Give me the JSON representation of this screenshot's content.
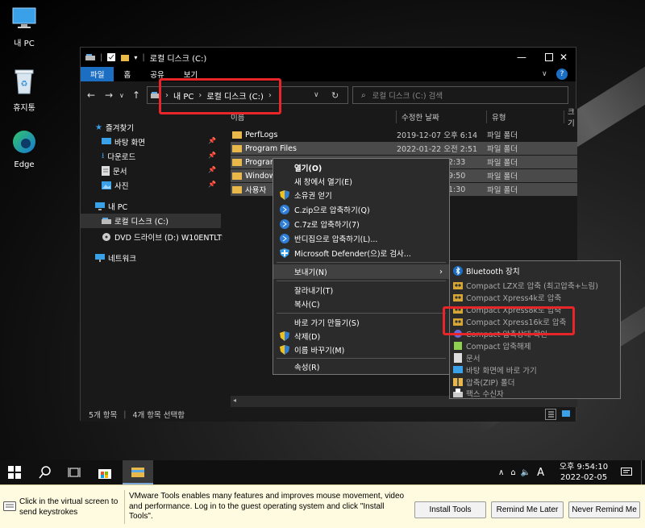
{
  "desktop": {
    "icons": [
      {
        "label": "내 PC",
        "icon": "computer-icon"
      },
      {
        "label": "휴지통",
        "icon": "recycle-bin-icon"
      },
      {
        "label": "Edge",
        "icon": "edge-icon"
      }
    ]
  },
  "window": {
    "title": "로컬 디스크 (C:)",
    "ribbon_tabs": [
      "파일",
      "홈",
      "공유",
      "보기"
    ],
    "address": {
      "crumbs": [
        "내 PC",
        "로컬 디스크 (C:)"
      ]
    },
    "search_placeholder": "로컬 디스크 (C:) 검색",
    "columns": [
      "이름",
      "수정한 날짜",
      "유형",
      "크기"
    ],
    "files": [
      {
        "name": "PerfLogs",
        "date": "2019-12-07 오후 6:14",
        "type": "파일 폴더",
        "selected": false
      },
      {
        "name": "Program Files",
        "date": "2022-01-22 오전 2:51",
        "type": "파일 폴더",
        "selected": true
      },
      {
        "name": "Program",
        "date": "2:33",
        "type": "파일 폴더",
        "selected": true
      },
      {
        "name": "Window",
        "date": "9:50",
        "type": "파일 폴더",
        "selected": true
      },
      {
        "name": "사용자",
        "date": "1:30",
        "type": "파일 폴더",
        "selected": true
      }
    ],
    "sidebar": [
      {
        "label": "즐겨찾기",
        "icon": "star-icon",
        "indent": 1,
        "pin": false
      },
      {
        "label": "바탕 화면",
        "icon": "desktop-icon",
        "indent": 2,
        "pin": true
      },
      {
        "label": "다운로드",
        "icon": "download-icon",
        "indent": 2,
        "pin": true
      },
      {
        "label": "문서",
        "icon": "document-icon",
        "indent": 2,
        "pin": true
      },
      {
        "label": "사진",
        "icon": "picture-icon",
        "indent": 2,
        "pin": true
      },
      {
        "label": "내 PC",
        "icon": "computer-icon",
        "indent": 1,
        "pin": false
      },
      {
        "label": "로컬 디스크 (C:)",
        "icon": "drive-icon",
        "indent": 2,
        "pin": false
      },
      {
        "label": "DVD 드라이브 (D:) W10ENTLTS",
        "icon": "dvd-icon",
        "indent": 2,
        "pin": false
      },
      {
        "label": "네트워크",
        "icon": "network-icon",
        "indent": 1,
        "pin": false
      }
    ],
    "status": {
      "count": "5개 항목",
      "selected": "4개 항목 선택함"
    }
  },
  "context_menu": {
    "items": [
      {
        "label": "열기(O)",
        "bold": true
      },
      {
        "label": "새 창에서 열기(E)"
      },
      {
        "label": "소유권 얻기",
        "icon": "shield-icon"
      },
      {
        "label": "C.zip으로 압축하기(Q)",
        "icon": "bandizip-icon"
      },
      {
        "label": "C.7z로 압축하기(7)",
        "icon": "bandizip-icon"
      },
      {
        "label": "반디집으로 압축하기(L)...",
        "icon": "bandizip-icon"
      },
      {
        "label": "Microsoft Defender(으)로 검사...",
        "icon": "defender-icon"
      },
      {
        "label": "보내기(N)",
        "submenu": true
      },
      {
        "label": "잘라내기(T)"
      },
      {
        "label": "복사(C)"
      },
      {
        "label": "바로 가기 만들기(S)"
      },
      {
        "label": "삭제(D)",
        "icon": "shield-icon"
      },
      {
        "label": "이름 바꾸기(M)",
        "icon": "shield-icon"
      },
      {
        "label": "속성(R)"
      }
    ]
  },
  "send_to_menu": {
    "items": [
      {
        "label": "Bluetooth 장치",
        "icon": "bluetooth-icon"
      },
      {
        "label": "Compact LZX로 압축 (최고압축+느림)",
        "icon": "compact-icon"
      },
      {
        "label": "Compact Xpress4k로 압축",
        "icon": "compact-icon"
      },
      {
        "label": "Compact Xpress8k로 압축",
        "icon": "compact-icon"
      },
      {
        "label": "Compact Xpress16k로 압축",
        "icon": "compact-icon"
      },
      {
        "label": "Compact 압축상태 확인",
        "icon": "info-icon"
      },
      {
        "label": "Compact 압축해제",
        "icon": "uncompress-icon"
      },
      {
        "label": "문서",
        "icon": "document-icon"
      },
      {
        "label": "바탕 화면에 바로 가기",
        "icon": "desktop-icon"
      },
      {
        "label": "압축(ZIP) 폴더",
        "icon": "zip-folder-icon"
      },
      {
        "label": "팩스 수신자",
        "icon": "fax-icon"
      }
    ]
  },
  "taskbar": {
    "time": "오후 9:54:10",
    "date": "2022-02-05",
    "ime": "A"
  },
  "vmware": {
    "hint": "Click in the virtual screen to send keystrokes",
    "message": "VMware Tools enables many features and improves mouse movement, video and performance. Log in to the guest operating system and click \"Install Tools\".",
    "buttons": [
      "Install Tools",
      "Remind Me Later",
      "Never Remind Me"
    ]
  },
  "colors": {
    "accent": "#1b6ec2",
    "highlight": "#e8262a",
    "folder": "#e8b94a",
    "vm_bar": "#fffbe0"
  }
}
